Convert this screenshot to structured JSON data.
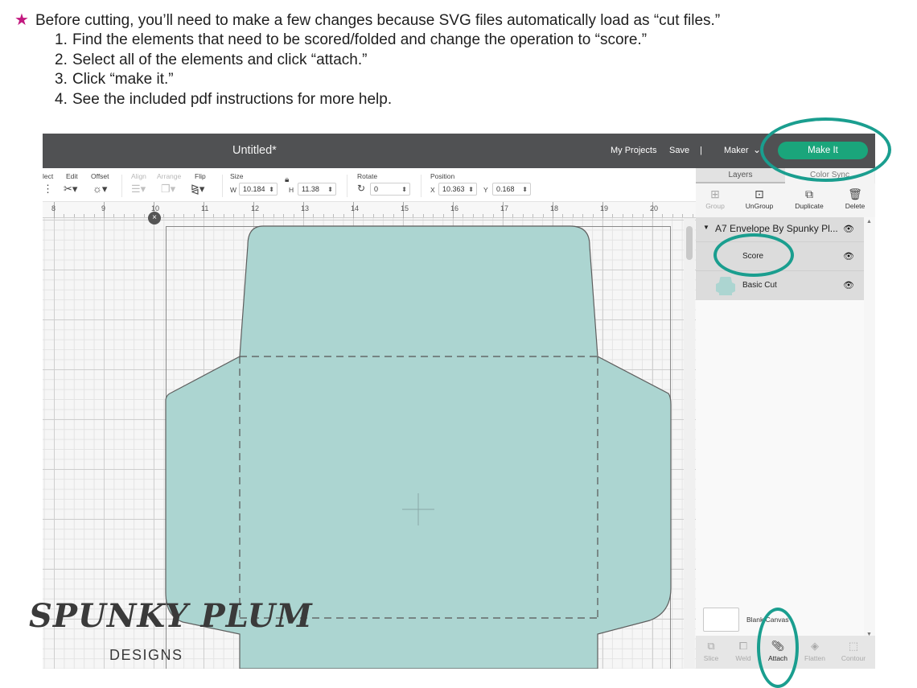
{
  "instructions": {
    "intro": "Before cutting, you’ll need to make  a few changes because SVG files automatically load as “cut files.”",
    "steps": [
      {
        "num": "1.",
        "text": "Find the elements that need to be scored/folded and change the operation to “score.”"
      },
      {
        "num": "2.",
        "text": "Select all of the elements and click “attach.”"
      },
      {
        "num": "3.",
        "text": "Click “make it.”"
      },
      {
        "num": "4.",
        "text": "See the included pdf instructions for more help."
      }
    ],
    "star_color": "#c2187f"
  },
  "header": {
    "title": "Untitled*",
    "my_projects": "My Projects",
    "save": "Save",
    "separator": "|",
    "machine": "Maker",
    "make_it": "Make It"
  },
  "toolbar": {
    "select": "lect",
    "edit": "Edit",
    "offset": "Offset",
    "align": "Align",
    "arrange": "Arrange",
    "flip": "Flip",
    "size": "Size",
    "w_label": "W",
    "w_value": "10.184",
    "h_label": "H",
    "h_value": "11.38",
    "rotate": "Rotate",
    "rotate_value": "0",
    "position": "Position",
    "x_label": "X",
    "x_value": "10.363",
    "y_label": "Y",
    "y_value": "0.168"
  },
  "ruler": {
    "labels": [
      "8",
      "9",
      "10",
      "11",
      "12",
      "13",
      "14",
      "15",
      "16",
      "17",
      "18",
      "19",
      "20"
    ]
  },
  "panel": {
    "tabs": [
      "Layers",
      "Color Sync"
    ],
    "actions": [
      "Group",
      "UnGroup",
      "Duplicate",
      "Delete"
    ],
    "group_name": "A7 Envelope By Spunky Pl...",
    "layers": [
      {
        "name": "Score"
      },
      {
        "name": "Basic Cut"
      }
    ],
    "blank_canvas": "Blank Canvas",
    "bottom_tools": [
      "Slice",
      "Weld",
      "Attach",
      "Flatten",
      "Contour"
    ]
  },
  "colors": {
    "envelope": "#acd5d1",
    "make_it": "#1aa57b",
    "annotation": "#1a9e8f"
  },
  "logo": {
    "word": "SPUNKY PLUM",
    "sub": "DESIGNS"
  }
}
